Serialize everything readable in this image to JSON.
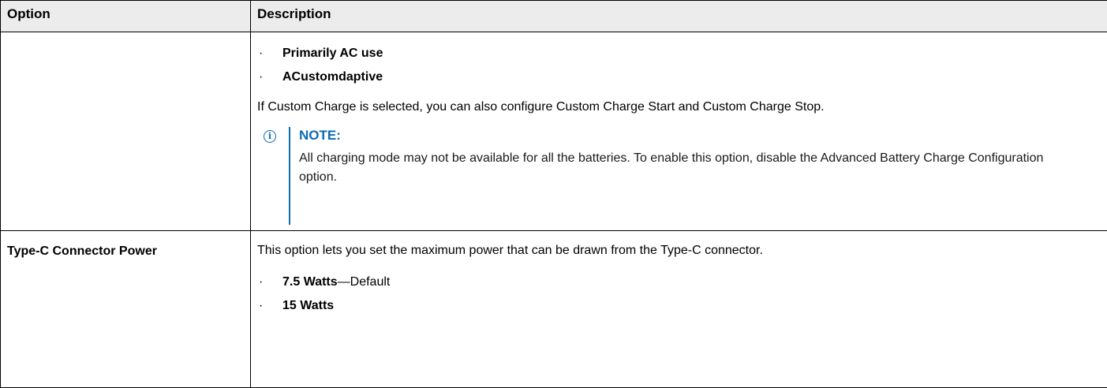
{
  "header": {
    "option_label": "Option",
    "description_label": "Description"
  },
  "rows": [
    {
      "option": "",
      "bullets": [
        {
          "bold": "Primarily AC use",
          "rest": ""
        },
        {
          "bold": "ACustomdaptive",
          "rest": ""
        }
      ],
      "paragraph": "If Custom Charge is selected, you can also configure Custom Charge Start and Custom Charge Stop.",
      "note": {
        "icon": "info-icon",
        "title": "NOTE:",
        "body": "All charging mode may not be available for all the batteries. To enable this option, disable the Advanced Battery Charge Configuration option."
      }
    },
    {
      "option": "Type-C Connector Power",
      "intro": "This option lets you set the maximum power that can be drawn from the Type-C connector.",
      "bullets": [
        {
          "bold": "7.5 Watts",
          "rest": "—Default"
        },
        {
          "bold": "15 Watts",
          "rest": ""
        }
      ]
    }
  ],
  "bullet_glyph": "·",
  "colors": {
    "note_accent": "#0b6bb5",
    "header_bg": "#ececec",
    "border": "#000000"
  }
}
